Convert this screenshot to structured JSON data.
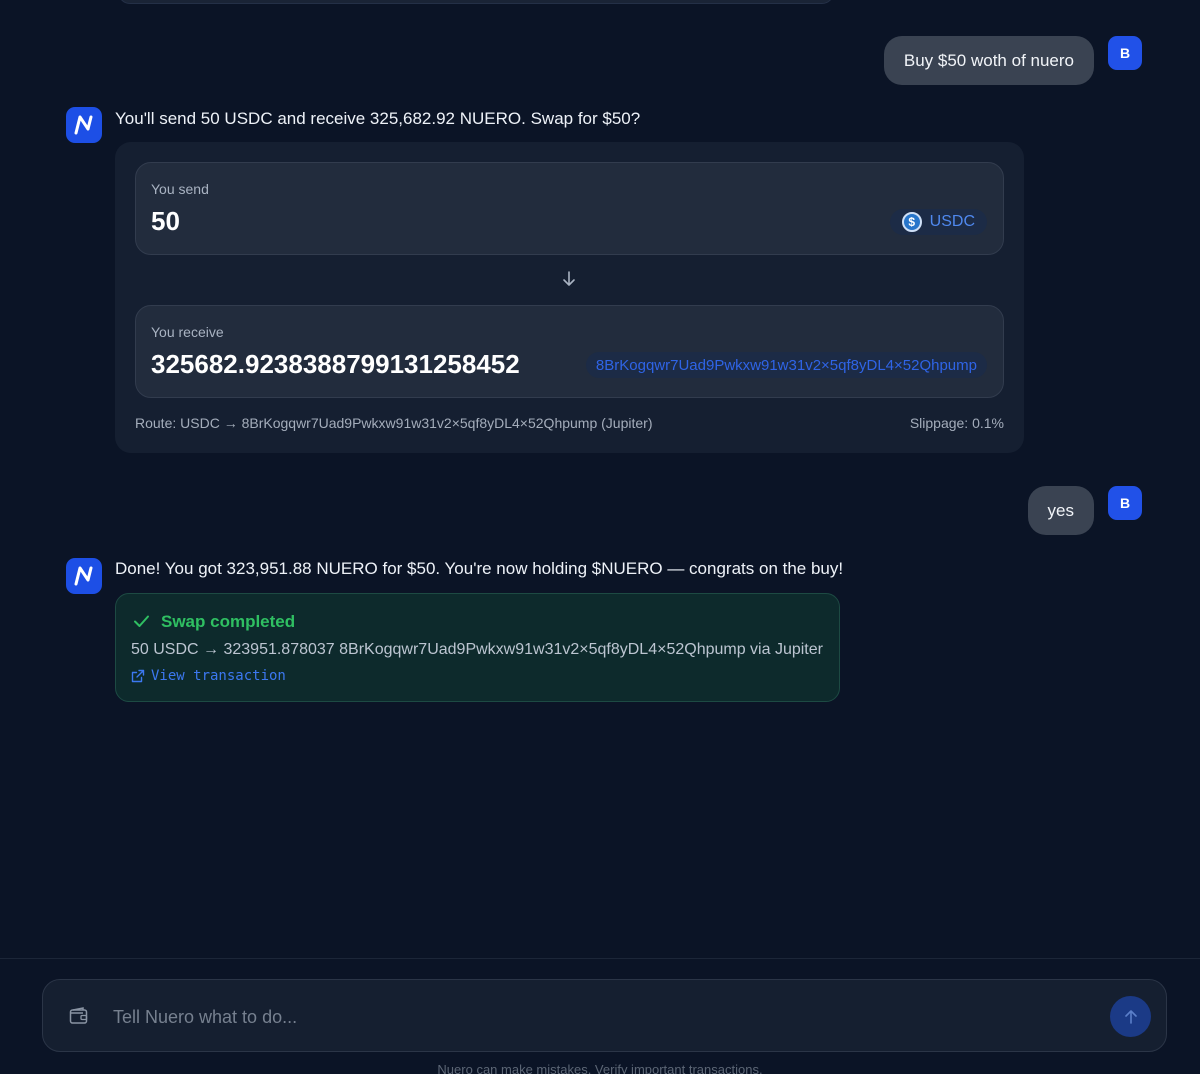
{
  "conversation": {
    "user_messages": [
      {
        "text": "Buy $50 woth of nuero",
        "avatar": "B"
      },
      {
        "text": "yes",
        "avatar": "B"
      }
    ],
    "assistant_messages": [
      {
        "text": "You'll send 50 USDC and receive 325,682.92 NUERO. Swap for $50?"
      },
      {
        "text": "Done! You got 323,951.88 NUERO for $50. You're now holding $NUERO — congrats on the buy!"
      }
    ]
  },
  "swap_quote": {
    "send_label": "You send",
    "send_amount": "50",
    "send_token": "USDC",
    "receive_label": "You receive",
    "receive_amount": "325682.9238388799131258452",
    "receive_token": "8BrKogqwr7Uad9Pwkxw91w31v2×5qf8yDL4×52Qhpump",
    "route": "Route: USDC → 8BrKogqwr7Uad9Pwkxw91w31v2×5qf8yDL4×52Qhpump (Jupiter)",
    "slippage": "Slippage: 0.1%"
  },
  "swap_result": {
    "title": "Swap completed",
    "detail": "50 USDC → 323951.878037 8BrKogqwr7Uad9Pwkxw91w31v2×5qf8yDL4×52Qhpump via Jupiter",
    "link_label": "View transaction"
  },
  "composer": {
    "placeholder": "Tell Nuero what to do...",
    "disclaimer": "Nuero can make mistakes. Verify important transactions."
  },
  "icons": {
    "bot_avatar": "nuero-logo-icon",
    "usdc": "usdc-icon",
    "arrow": "arrow-down-icon",
    "check": "check-icon",
    "external_link": "external-link-icon",
    "wallet": "wallet-icon",
    "send": "arrow-up-icon"
  },
  "colors": {
    "background": "#0b1426",
    "accent": "#1d4fe6",
    "success": "#2fbf62",
    "link": "#3c78f0"
  }
}
